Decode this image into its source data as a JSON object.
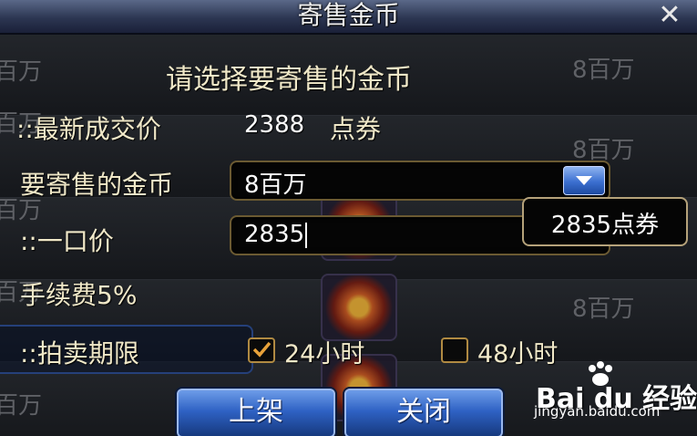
{
  "dialog": {
    "title": "寄售金币",
    "instruction": "请选择要寄售的金币",
    "latest_price_label": "::最新成交价",
    "latest_price_value": "2388",
    "latest_price_unit": "点券",
    "amount_label": "要寄售的金币",
    "amount_selected": "8百万",
    "buyout_label": "::一口价",
    "buyout_value": "2835",
    "buyout_tooltip": "2835点券",
    "fee_label": "手续费5%",
    "duration_label": "::拍卖期限",
    "duration_options": [
      {
        "label": "24小时",
        "checked": true
      },
      {
        "label": "48小时",
        "checked": false
      }
    ],
    "list_button": "上架",
    "close_button": "关闭"
  },
  "background_list": {
    "left_labels": [
      "百万",
      "百万",
      "百万",
      "百万",
      "百万"
    ],
    "right_labels": [
      "8百万",
      "8百万",
      "8百万"
    ]
  },
  "watermark": {
    "brand": "Bai du 经验",
    "url": "jingyan.baidu.com"
  },
  "icons": [
    "close-x-icon",
    "dropdown-arrow-icon",
    "checkmark-icon",
    "gold-coin-icon",
    "paw-icon"
  ],
  "colors": {
    "title_bar": "#2c3652",
    "label_text": "#f0e8c8",
    "field_border": "#6b5a32",
    "button_blue": "#2f62c4"
  }
}
